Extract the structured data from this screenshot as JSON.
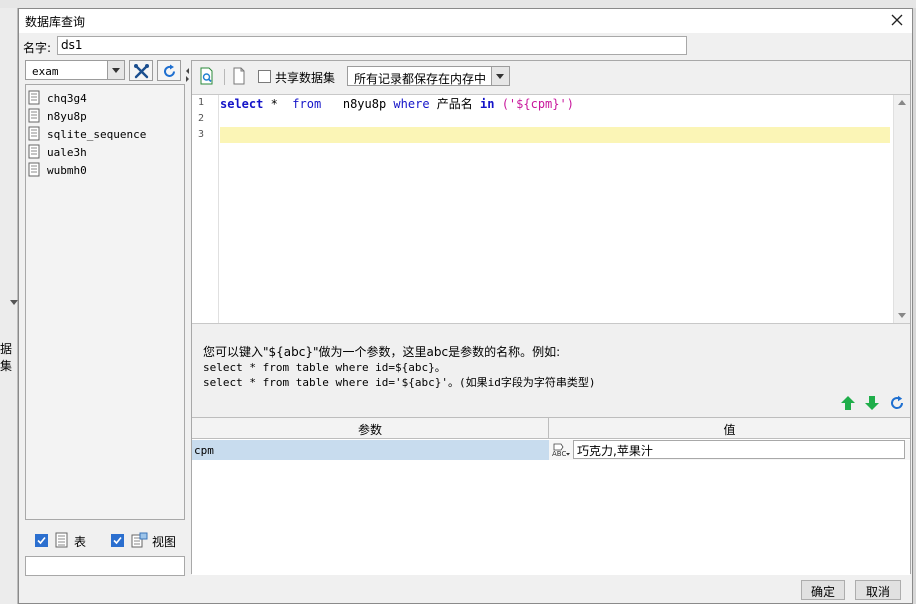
{
  "dialog": {
    "title": "数据库查询",
    "name_label": "名字:",
    "name_value": "ds1"
  },
  "background": {
    "left_label": "据集"
  },
  "left_pane": {
    "database_selected": "exam",
    "tables": [
      "chq3g4",
      "n8yu8p",
      "sqlite_sequence",
      "uale3h",
      "wubmh0"
    ],
    "filter_tables_label": "表",
    "filter_views_label": "视图",
    "filter_tables_checked": true,
    "filter_views_checked": true,
    "search_value": ""
  },
  "toolbar": {
    "share_dataset_label": "共享数据集",
    "share_dataset_checked": false,
    "memory_mode_selected": "所有记录都保存在内存中"
  },
  "editor": {
    "line_numbers": [
      "1",
      "2",
      "3"
    ],
    "line1": {
      "kw_select": "select",
      "star": " *  ",
      "kw_from": "from",
      "table": "   n8yu8p ",
      "kw_where": "where",
      "column": " 产品名 ",
      "kw_in": "in",
      "space": " ",
      "open_paren": "(",
      "param_str": "'${cpm}'",
      "close_paren": ")"
    }
  },
  "help": {
    "line1": "您可以键入\"${abc}\"做为一个参数，这里abc是参数的名称。例如:",
    "line2": "select * from table where id=${abc}。",
    "line3": "select * from table where id='${abc}'。(如果id字段为字符串类型)"
  },
  "params": {
    "header_param": "参数",
    "header_value": "值",
    "rows": [
      {
        "name": "cpm",
        "value": "巧克力,苹果汁"
      }
    ]
  },
  "buttons": {
    "ok": "确定",
    "cancel": "取消"
  },
  "colors": {
    "keyword": "#1414c8",
    "string": "#c8189c",
    "current_line_highlight": "#fbf5b6",
    "selected_row": "#c8dcee",
    "arrow_green": "#1fae4a",
    "refresh_blue": "#1e6fd0"
  }
}
